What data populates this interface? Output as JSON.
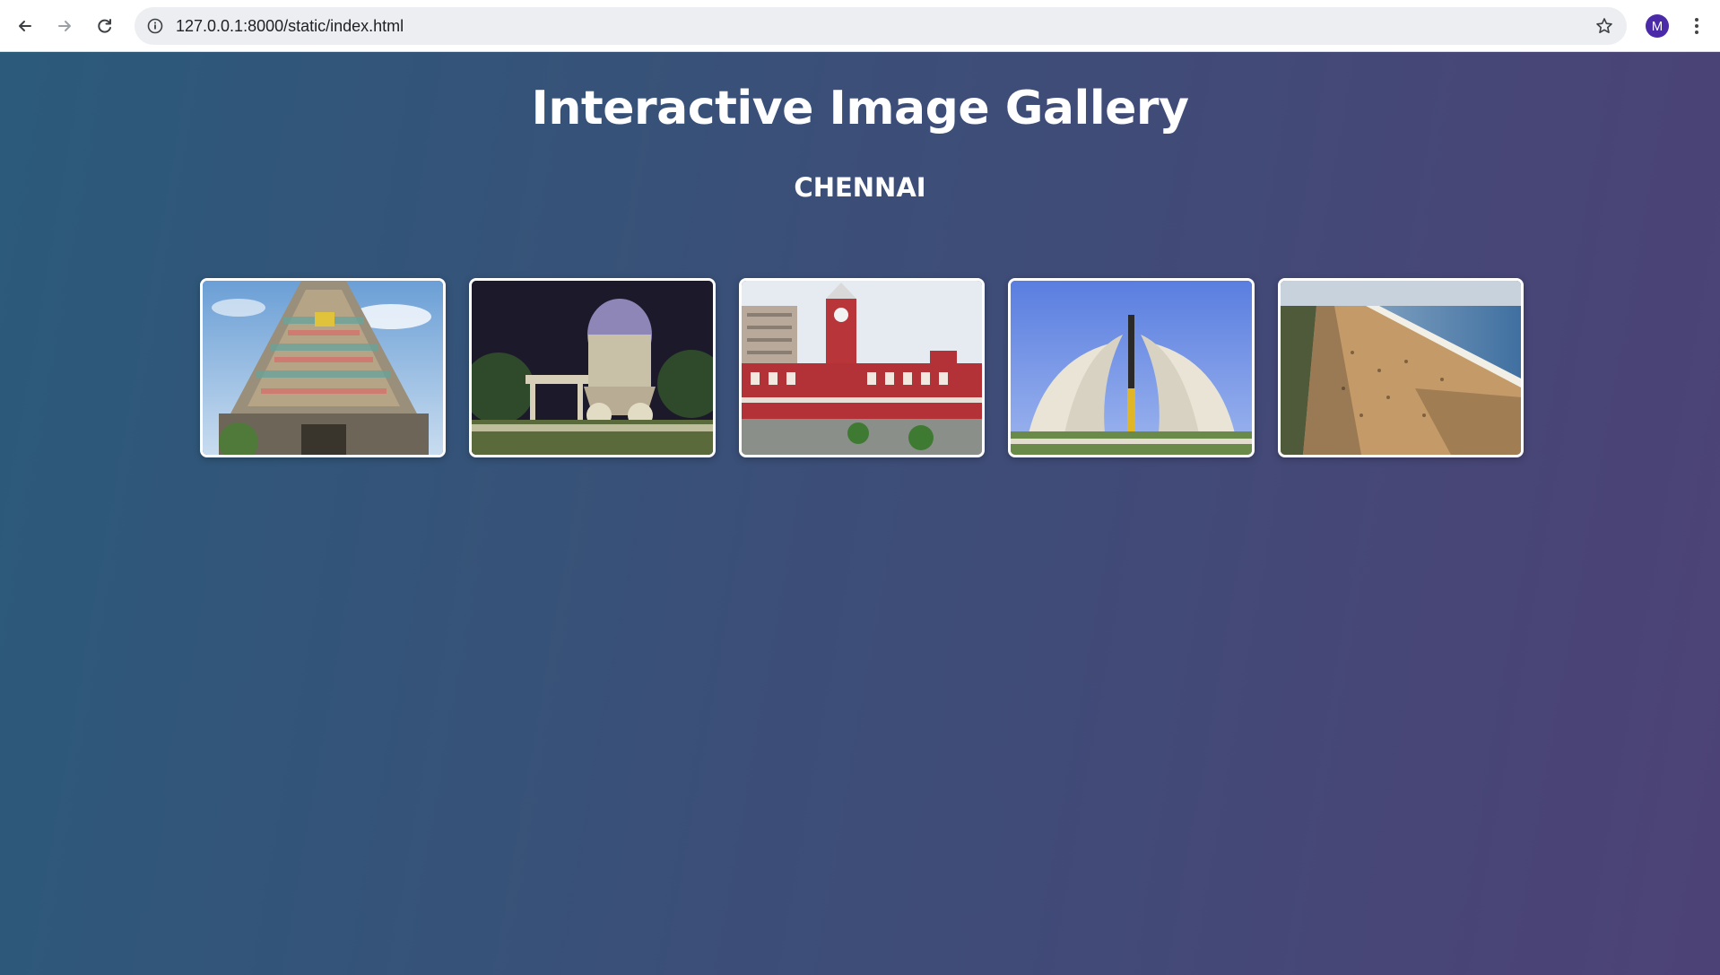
{
  "browser": {
    "url": "127.0.0.1:8000/static/index.html",
    "profile_initial": "M"
  },
  "page": {
    "title": "Interactive Image Gallery",
    "subtitle": "CHENNAI"
  },
  "gallery": {
    "images": [
      {
        "subject": "temple-gopuram"
      },
      {
        "subject": "stone-chariot-monument-night"
      },
      {
        "subject": "red-railway-station"
      },
      {
        "subject": "memorial-arches"
      },
      {
        "subject": "beach-aerial"
      }
    ]
  },
  "colors": {
    "gradient_start": "#2b5a7a",
    "gradient_end": "#4d4276",
    "avatar": "#4a2aa8"
  }
}
